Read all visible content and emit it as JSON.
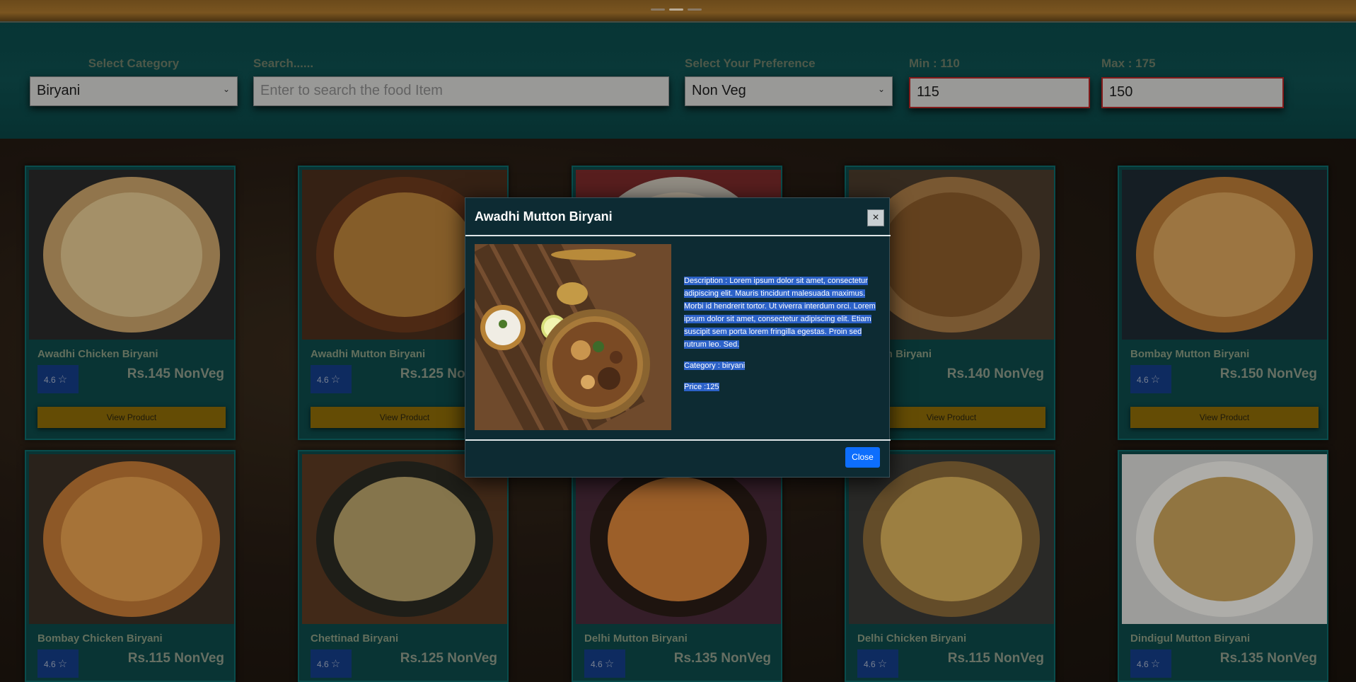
{
  "filters": {
    "category_label": "Select Category",
    "category_value": "Biryani",
    "search_label": "Search......",
    "search_placeholder": "Enter to search the food Item",
    "preference_label": "Select Your Preference",
    "preference_value": "Non Veg",
    "min_label": "Min : 110",
    "min_value": "115",
    "max_label": "Max : 175",
    "max_value": "150"
  },
  "products": [
    {
      "name": "Awadhi Chicken Biryani",
      "rating": "4.6",
      "price": "Rs.145 NonVeg",
      "button": "View Product"
    },
    {
      "name": "Awadhi Mutton Biryani",
      "rating": "4.6",
      "price": "Rs.125 NonVeg",
      "button": "View Product"
    },
    {
      "name": "",
      "rating": "",
      "price": "",
      "button": ""
    },
    {
      "name": "Mutton Biryani",
      "rating": "",
      "price": "Rs.140 NonVeg",
      "button": "View Product"
    },
    {
      "name": "Bombay Mutton Biryani",
      "rating": "4.6",
      "price": "Rs.150 NonVeg",
      "button": "View Product"
    },
    {
      "name": "Bombay Chicken Biryani",
      "rating": "4.6",
      "price": "Rs.115 NonVeg",
      "button": ""
    },
    {
      "name": "Chettinad Biryani",
      "rating": "4.6",
      "price": "Rs.125 NonVeg",
      "button": ""
    },
    {
      "name": "Delhi Mutton Biryani",
      "rating": "4.6",
      "price": "Rs.135 NonVeg",
      "button": ""
    },
    {
      "name": "Delhi Chicken Biryani",
      "rating": "4.6",
      "price": "Rs.115 NonVeg",
      "button": ""
    },
    {
      "name": "Dindigul Mutton Biryani",
      "rating": "4.6",
      "price": "Rs.135 NonVeg",
      "button": ""
    }
  ],
  "modal": {
    "title": "Awadhi Mutton Biryani",
    "close_x": "×",
    "description": "Description : Lorem ipsum dolor sit amet, consectetur adipiscing elit. Mauris tincidunt malesuada maximus. Morbi id hendrerit tortor. Ut viverra interdum orci. Lorem ipsum dolor sit amet, consectetur adipiscing elit. Etiam suscipit sem porta lorem fringilla egestas. Proin sed rutrum leo. Sed.",
    "category": "Category : biryani",
    "price": "Price :125",
    "close_button": "Close"
  },
  "icons": {
    "star": "star-outline-icon",
    "chevron": "chevron-down-icon",
    "close": "close-icon"
  }
}
